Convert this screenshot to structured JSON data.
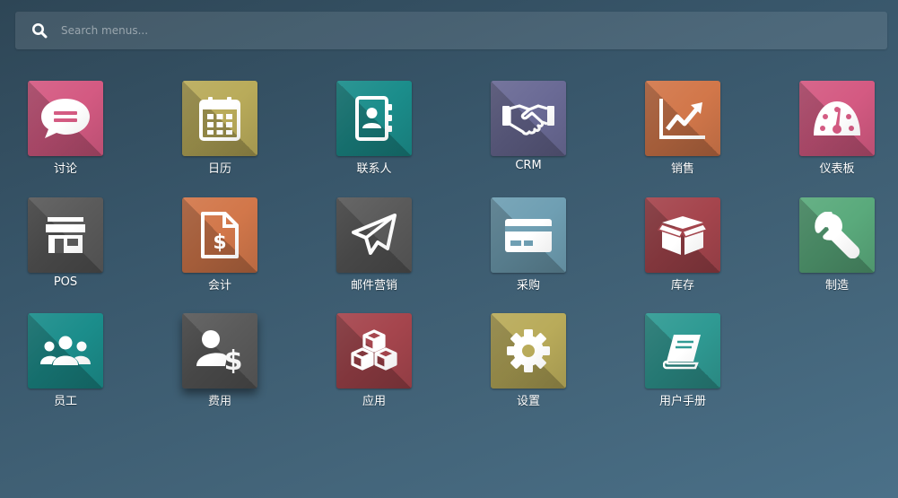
{
  "search": {
    "placeholder": "Search menus..."
  },
  "apps": [
    {
      "label": "讨论",
      "icon": "chat-bubble-icon",
      "color": "#d45a82"
    },
    {
      "label": "日历",
      "icon": "calendar-icon",
      "color": "#b9ab5a"
    },
    {
      "label": "联系人",
      "icon": "address-book-icon",
      "color": "#1b8d8b"
    },
    {
      "label": "CRM",
      "icon": "handshake-icon",
      "color": "#6a6a95"
    },
    {
      "label": "销售",
      "icon": "sales-chart-icon",
      "color": "#d2774a"
    },
    {
      "label": "仪表板",
      "icon": "dashboard-gauge-icon",
      "color": "#d45a82"
    },
    {
      "label": "POS",
      "icon": "store-icon",
      "color": "#5a5a5a"
    },
    {
      "label": "会计",
      "icon": "invoice-dollar-icon",
      "color": "#d2774a"
    },
    {
      "label": "邮件营销",
      "icon": "paper-plane-icon",
      "color": "#5a5a5a"
    },
    {
      "label": "采购",
      "icon": "credit-card-icon",
      "color": "#6f9fb3"
    },
    {
      "label": "库存",
      "icon": "box-icon",
      "color": "#a5454d"
    },
    {
      "label": "制造",
      "icon": "wrench-icon",
      "color": "#5aaa7c"
    },
    {
      "label": "员工",
      "icon": "team-users-icon",
      "color": "#1b8d8b"
    },
    {
      "label": "费用",
      "icon": "user-dollar-icon",
      "color": "#5a5a5a"
    },
    {
      "label": "应用",
      "icon": "cubes-icon",
      "color": "#a5454d"
    },
    {
      "label": "设置",
      "icon": "gear-icon",
      "color": "#b9ab5a"
    },
    {
      "label": "用户手册",
      "icon": "book-icon",
      "color": "#2f9a93"
    }
  ]
}
